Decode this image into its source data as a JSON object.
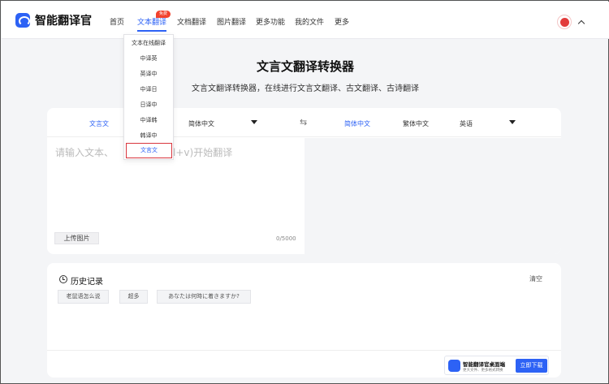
{
  "header": {
    "brand": "智能翻译官",
    "nav": [
      {
        "label": "首页"
      },
      {
        "label": "文本翻译",
        "badge": "免费"
      },
      {
        "label": "文档翻译"
      },
      {
        "label": "图片翻译"
      },
      {
        "label": "更多功能"
      },
      {
        "label": "我的文件"
      },
      {
        "label": "更多"
      }
    ],
    "accent": "#2d62f5"
  },
  "dropdown": {
    "items": [
      "文本在线翻译",
      "中译英",
      "英译中",
      "中译日",
      "日译中",
      "中译韩",
      "韩译中",
      "文言文"
    ],
    "highlighted": "文言文"
  },
  "main": {
    "title": "文言文翻译转换器",
    "subtitle": "文言文翻译转换器，在线进行文言文翻译、古文翻译、古诗翻译"
  },
  "translator": {
    "source_lang": "文言文",
    "source_option": "简体中文",
    "target_options": [
      "简体中文",
      "繁体中文",
      "英语"
    ],
    "placeholder": "请输入文本、或粘贴（Ctrl+v)开始翻译",
    "placeholder_left": "请输入文本、",
    "placeholder_right": "Ctrl+v)开始翻译",
    "upload_label": "上传图片",
    "counter": "0/5000"
  },
  "history": {
    "title": "历史记录",
    "clear_label": "清空",
    "items": [
      "老鼠语怎么说",
      "超多",
      "あなたは何時に着きますか?"
    ]
  },
  "promo": {
    "title": "智能翻译官桌面端",
    "subtitle": "更大文件、更多格式转换",
    "button": "立即下载"
  }
}
